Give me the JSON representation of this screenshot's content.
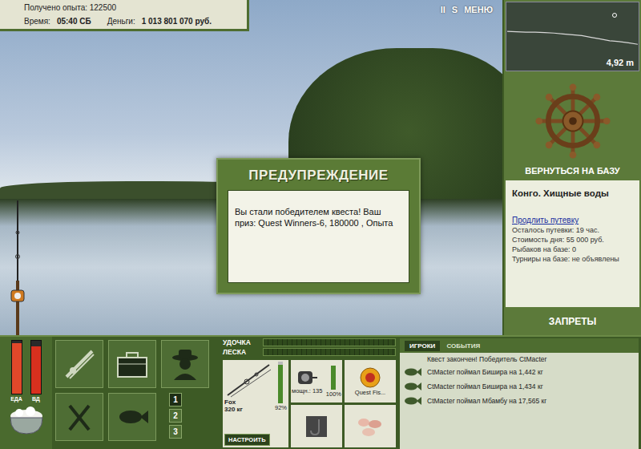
{
  "hud": {
    "experience": "Получено опыта: 122500",
    "time_label": "Время:",
    "time": "05:40 СБ",
    "money_label": "Деньги:",
    "money": "1 013 801 070 руб."
  },
  "top_buttons": [
    {
      "label": "II"
    },
    {
      "label": "S"
    },
    {
      "label": "МЕНЮ"
    }
  ],
  "depth_chart": {
    "reading": "4,92 m",
    "max": 8,
    "values": [
      3.4,
      3.45,
      3.5,
      3.5,
      3.55,
      3.6,
      3.7,
      3.8,
      3.9,
      4.1,
      4.3,
      4.5,
      4.6,
      4.75,
      4.92
    ]
  },
  "base": {
    "return_button": "ВЕРНУТЬСЯ НА БАЗУ",
    "location": "Конго. Хищные воды",
    "extend_link": "Продлить путевку",
    "details": [
      "Осталось путевки: 19 час.",
      "Стоимость дня: 55 000 руб.",
      "Рыбаков на базе: 0",
      "Турниры на базе: не объявлены"
    ],
    "bans_button": "ЗАПРЕТЫ"
  },
  "dialog": {
    "title": "ПРЕДУПРЕЖДЕНИЕ",
    "message": "Вы стали победителем квеста! Ваш приз: Quest Winners-6, 180000 , Опыта"
  },
  "meters": [
    {
      "label": "ЕДА",
      "level": 0.95,
      "color": "#e0482a"
    },
    {
      "label": "ВД",
      "level": 0.9,
      "color": "#d8301e"
    }
  ],
  "slots": [
    {
      "label": "1",
      "selected": true
    },
    {
      "label": "2",
      "selected": false
    },
    {
      "label": "3",
      "selected": false
    }
  ],
  "gauges": [
    {
      "label": "УДОЧКА",
      "level": 0
    },
    {
      "label": "ЛЕСКА",
      "level": 0
    }
  ],
  "tackle": {
    "rod": {
      "name": "Fox",
      "load": "320 кг",
      "reading": "92%",
      "level": 0.92
    },
    "reel": {
      "power": "мощн.: 135",
      "reading": "100%",
      "level": 1
    },
    "line": {
      "name": "Quest Fis..."
    },
    "setup_button": "НАСТРОИТЬ"
  },
  "feed": {
    "tabs": [
      {
        "label": "ИГРОКИ",
        "selected": true
      },
      {
        "label": "СОБЫТИЯ",
        "selected": false
      }
    ],
    "messages": [
      {
        "kind": "notice",
        "text": "Квест закончен! Победитель CtMacter"
      },
      {
        "kind": "catch",
        "text": "CtMacter поймал Бишира на 1,442 кг"
      },
      {
        "kind": "catch",
        "text": "CtMacter поймал Бишира на 1,434 кг"
      },
      {
        "kind": "catch",
        "text": "CtMacter поймал Мбамбу на 17,565 кг"
      }
    ]
  }
}
